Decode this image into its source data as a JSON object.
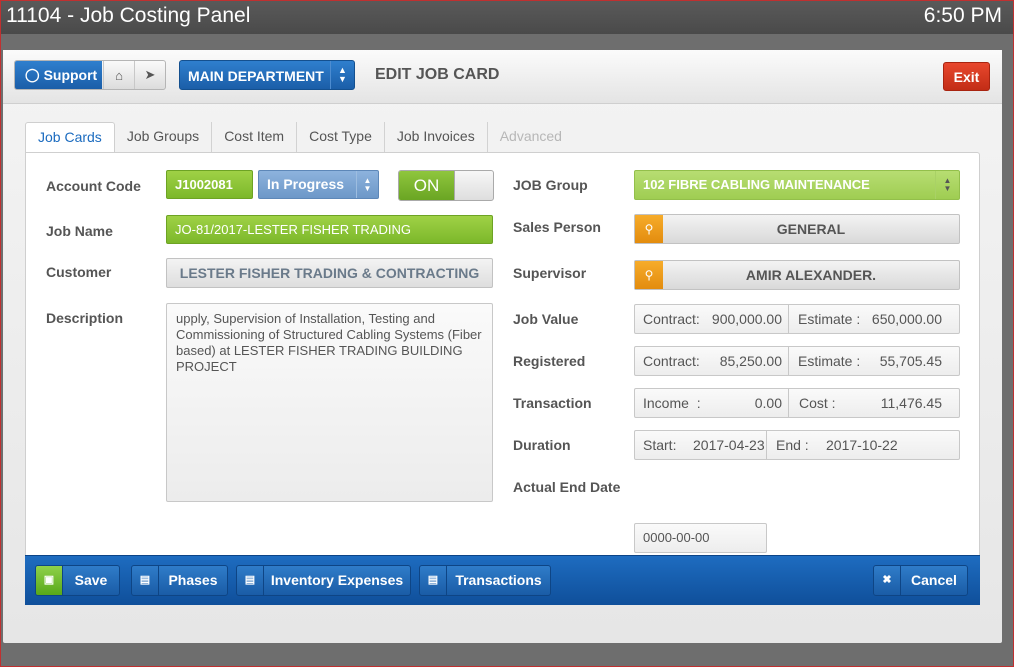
{
  "window": {
    "title": "11104 - Job Costing Panel",
    "clock": "6:50 PM"
  },
  "toolbar": {
    "support_label": "Support",
    "department_label": "MAIN DEPARTMENT",
    "heading": "EDIT JOB CARD",
    "exit_label": "Exit"
  },
  "tabs": [
    {
      "label": "Job Cards",
      "state": "active"
    },
    {
      "label": "Job Groups",
      "state": "normal"
    },
    {
      "label": "Cost Item",
      "state": "normal"
    },
    {
      "label": "Cost Type",
      "state": "normal"
    },
    {
      "label": "Job Invoices",
      "state": "normal"
    },
    {
      "label": "Advanced",
      "state": "disabled"
    }
  ],
  "form": {
    "account_code": {
      "label": "Account Code",
      "value": "J1002081"
    },
    "status": {
      "value": "In Progress"
    },
    "active_toggle": {
      "value": "ON"
    },
    "job_name": {
      "label": "Job Name",
      "value": "JO-81/2017-LESTER FISHER TRADING"
    },
    "customer": {
      "label": "Customer",
      "value": "LESTER FISHER TRADING & CONTRACTING"
    },
    "description": {
      "label": "Description",
      "value": "upply, Supervision of Installation, Testing and Commissioning of Structured Cabling Systems (Fiber based) at LESTER FISHER TRADING BUILDING PROJECT"
    },
    "job_group": {
      "label": "JOB Group",
      "value": "102 FIBRE CABLING MAINTENANCE"
    },
    "sales_person": {
      "label": "Sales Person",
      "value": "GENERAL"
    },
    "supervisor": {
      "label": "Supervisor",
      "value": "AMIR ALEXANDER."
    },
    "job_value": {
      "label": "Job Value",
      "contract_label": "Contract:",
      "contract": "900,000.00",
      "estimate_label": "Estimate :",
      "estimate": "650,000.00"
    },
    "registered": {
      "label": "Registered",
      "contract_label": "Contract:",
      "contract": "85,250.00",
      "estimate_label": "Estimate :",
      "estimate": "55,705.45"
    },
    "transaction": {
      "label": "Transaction",
      "income_label": "Income  :",
      "income": "0.00",
      "cost_label": "Cost :",
      "cost": "11,476.45"
    },
    "duration": {
      "label": "Duration",
      "start_label": "Start:",
      "start": "2017-04-23",
      "end_label": "End :",
      "end": "2017-10-22"
    },
    "actual_end_date": {
      "label": "Actual End Date",
      "value": "0000-00-00"
    }
  },
  "footer": {
    "save_label": "Save",
    "phases_label": "Phases",
    "inventory_label": "Inventory Expenses",
    "transactions_label": "Transactions",
    "cancel_label": "Cancel"
  },
  "icons": {
    "support": "lifebuoy-icon",
    "home": "home-icon",
    "tag": "tag-icon",
    "search": "search-icon",
    "save": "inbox-tray-icon",
    "document": "document-icon",
    "cancel": "close-circle-icon"
  },
  "colors": {
    "primary_blue": "#1b5ea8",
    "field_green": "#7cb82a",
    "status_blue": "#6d98c8",
    "lookup_orange": "#e38c0e",
    "exit_red": "#c22d16"
  }
}
